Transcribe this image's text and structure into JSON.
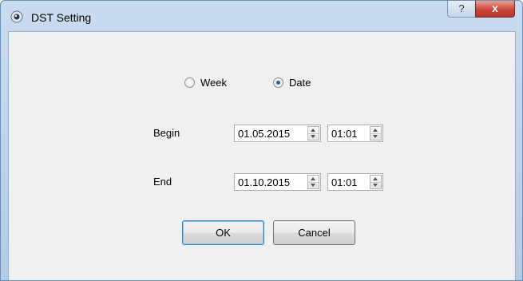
{
  "window": {
    "title": "DST Setting",
    "help_glyph": "?",
    "close_glyph": "x"
  },
  "mode": {
    "options": [
      {
        "label": "Week",
        "selected": false
      },
      {
        "label": "Date",
        "selected": true
      }
    ]
  },
  "begin": {
    "label": "Begin",
    "date": "01.05.2015",
    "time": "01:01"
  },
  "end": {
    "label": "End",
    "date": "01.10.2015",
    "time": "01:01"
  },
  "buttons": {
    "ok": "OK",
    "cancel": "Cancel"
  },
  "colors": {
    "titlebar": "#c9dcf0",
    "client_bg": "#f0f0f0",
    "close_red": "#c8473a",
    "radio_dot": "#2f5f8f"
  }
}
